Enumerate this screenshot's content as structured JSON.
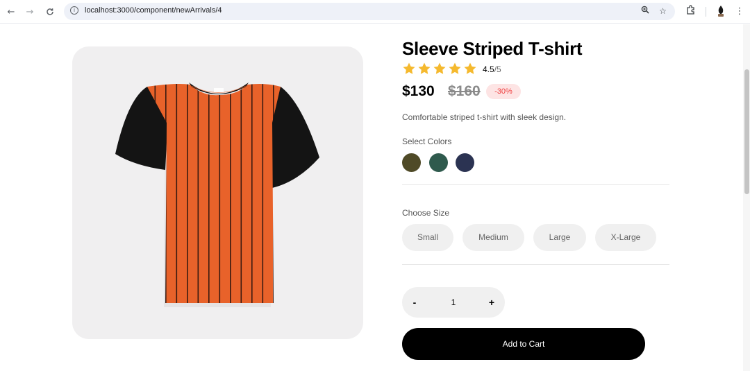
{
  "browser": {
    "url": "localhost:3000/component/newArrivals/4",
    "icons": [
      "back-icon",
      "forward-icon",
      "reload-icon",
      "site-info-icon",
      "zoom-icon",
      "bookmark-star-icon",
      "extensions-icon",
      "profile-icon",
      "menu-icon"
    ]
  },
  "product": {
    "title": "Sleeve Striped T-shirt",
    "rating_value": "4.5",
    "rating_max": "/5",
    "stars_filled": 4.5,
    "price": "$130",
    "old_price": "$160",
    "discount": "-30%",
    "description": "Comfortable striped t-shirt with sleek design.",
    "colors_label": "Select Colors",
    "colors": [
      "#4f4a27",
      "#2f5a4d",
      "#2b3352"
    ],
    "size_label": "Choose Size",
    "sizes": [
      "Small",
      "Medium",
      "Large",
      "X-Large"
    ],
    "quantity": "1",
    "minus_label": "-",
    "plus_label": "+",
    "add_to_cart": "Add to Cart",
    "image_colors": {
      "body": "#e8622a",
      "sleeves": "#141414",
      "stripes": "#3a1a10",
      "background": "#f0eff0"
    }
  }
}
